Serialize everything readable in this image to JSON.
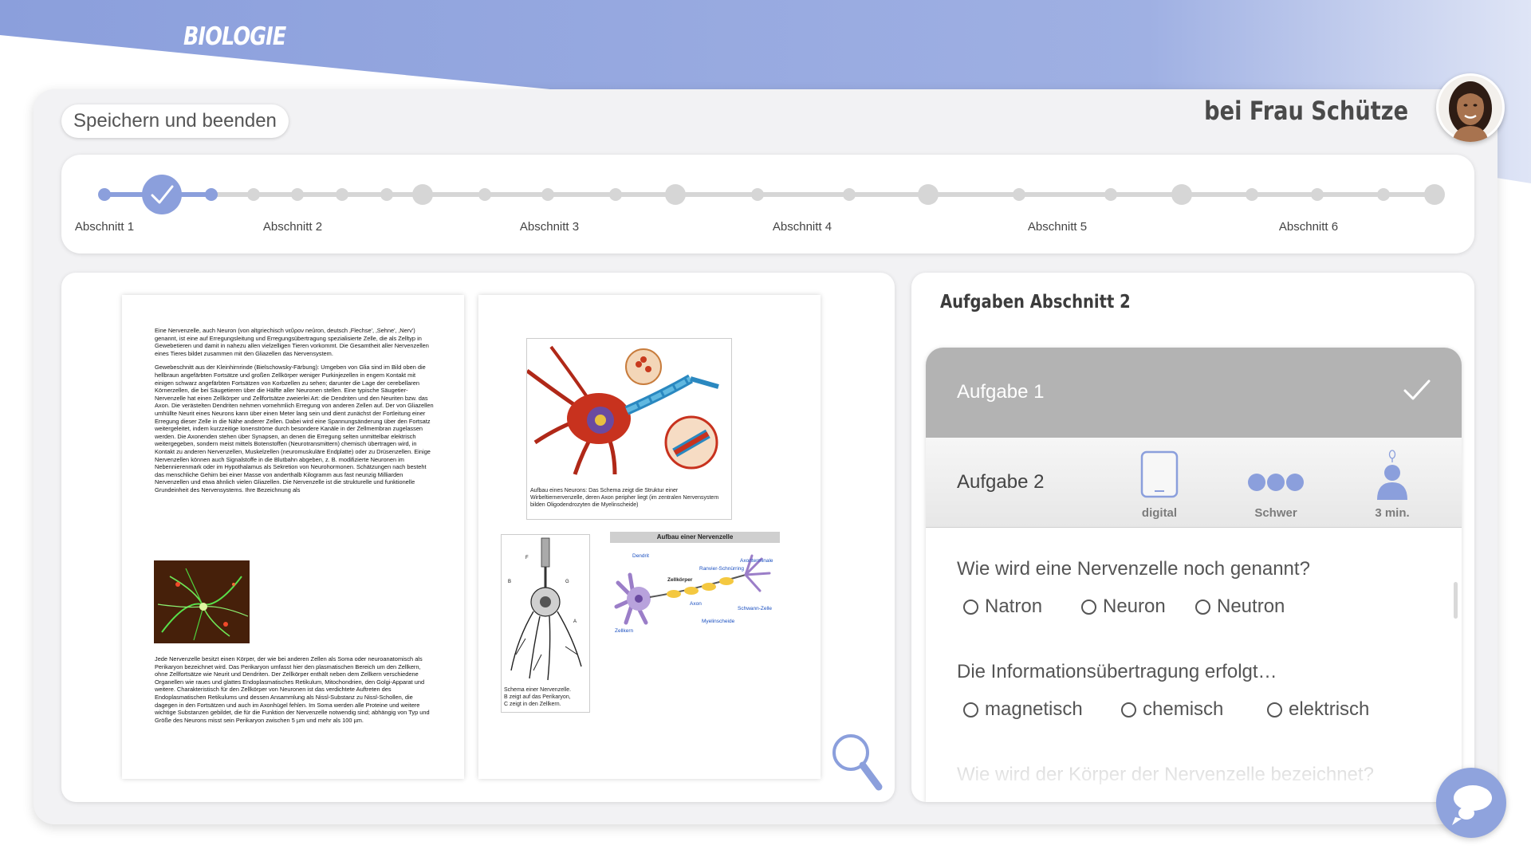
{
  "header": {
    "subject": "BIOLOGIE",
    "teacher": "bei Frau Schütze"
  },
  "toolbar": {
    "save_label": "Speichern und beenden"
  },
  "progress": {
    "steps": [
      "Abschnitt 1",
      "Abschnitt 2",
      "Abschnitt 3",
      "Abschnitt 4",
      "Abschnitt 5",
      "Abschnitt 6"
    ],
    "completed_steps": 1
  },
  "document": {
    "page1_paragraphs": [
      "Eine Nervenzelle, auch Neuron (von altgriechisch νεῦρον neûron, deutsch ‚Flechse', ‚Sehne', ‚Nerv') genannt, ist eine auf Erregungsleitung und Erregungsübertragung spezialisierte Zelle, die als Zelltyp in Gewebetieren und damit in nahezu allen vielzelligen Tieren vorkommt. Die Gesamtheit aller Nervenzellen eines Tieres bildet zusammen mit den Gliazellen das Nervensystem.",
      "Gewebeschnitt aus der Kleinhirnrinde (Bielschowsky-Färbung): Umgeben von Glia sind im Bild oben die hellbraun angefärbten Fortsätze und großen Zellkörper weniger Purkinjezellen in engem Kontakt mit einigen schwarz angefärbten Fortsätzen von Korbzellen zu sehen; darunter die Lage der cerebellaren Körnerzellen, die bei Säugetieren über die Hälfte aller Neuronen stellen. Eine typische Säugetier-Nervenzelle hat einen Zellkörper und Zellfortsätze zweierlei Art: die Dendriten und den Neuriten bzw. das Axon. Die verästelten Dendriten nehmen vornehmlich Erregung von anderen Zellen auf. Der von Gliazellen umhüllte Neurit eines Neurons kann über einen Meter lang sein und dient zunächst der Fortleitung einer Erregung dieser Zelle in die Nähe anderer Zellen. Dabei wird eine Spannungsänderung über den Fortsatz weitergeleitet, indem kurzzeitige Ionenströme durch besondere Kanäle in der Zellmembran zugelassen werden. Die Axonenden stehen über Synapsen, an denen die Erregung selten unmittelbar elektrisch weitergegeben, sondern meist mittels Botenstoffen (Neurotransmittern) chemisch übertragen wird, in Kontakt zu anderen Nervenzellen, Muskelzellen (neuromuskuläre Endplatte) oder zu Drüsenzellen. Einige Nervenzellen können auch Signalstoffe in die Blutbahn abgeben, z. B. modifizierte Neuronen im Nebennierenmark oder im Hypothalamus als Sekretion von Neurohormonen. Schätzungen nach besteht das menschliche Gehirn bei einer Masse von anderthalb Kilogramm aus fast neunzig Milliarden Nervenzellen und etwa ähnlich vielen Gliazellen. Die Nervenzelle ist die strukturelle und funktionelle Grundeinheit des Nervensystems. Ihre Bezeichnung als",
      "Jede Nervenzelle besitzt einen Körper, der wie bei anderen Zellen als Soma oder neuroanatomisch als Perikaryon bezeichnet wird. Das Perikaryon umfasst hier den plasmatischen Bereich um den Zellkern, ohne Zellfortsätze wie Neurit und Dendriten. Der Zellkörper enthält neben dem Zellkern verschiedene Organellen wie raues und glattes Endoplasmatisches Retikulum, Mitochondrien, den Golgi-Apparat und weitere. Charakteristisch für den Zellkörper von Neuronen ist das verdichtete Auftreten des Endoplasmatischen Retikulums und dessen Ansammlung als Nissl-Substanz zu Nissl-Schollen, die dagegen in den Fortsätzen und auch im Axonhügel fehlen. Im Soma werden alle Proteine und weitere wichtige Substanzen gebildet, die für die Funktion der Nervenzelle notwendig sind; abhängig von Typ und Größe des Neurons misst sein Perikaryon zwischen 5 µm und mehr als 100 µm."
    ],
    "fig1_caption": "Aufbau eines Neurons: Das Schema zeigt die Struktur einer Wirbeltiernervenzelle, deren Axon peripher liegt (im zentralen Nervensystem bilden Oligodendrozyten die Myelinscheide)",
    "fig2_caption_lines": [
      "Schema einer Nervenzelle.",
      "B zeigt auf das Perikaryon,",
      "C zeigt in den Zellkern."
    ],
    "fig3_title": "Aufbau einer Nervenzelle",
    "fig3_labels": [
      "Dendrit",
      "Zellkörper",
      "Ranvier-Schnürring",
      "Axonterminale",
      "Axon",
      "Schwann-Zelle",
      "Myelinscheide",
      "Zellkern"
    ]
  },
  "tasks": {
    "heading": "Aufgaben Abschnitt 2",
    "task1": {
      "label": "Aufgabe 1",
      "done": true
    },
    "task2": {
      "label": "Aufgabe 2",
      "mode": "digital",
      "difficulty": "Schwer",
      "duration": "3 min."
    },
    "questions": [
      {
        "text": "Wie wird eine Nervenzelle noch genannt?",
        "options": [
          "Natron",
          "Neuron",
          "Neutron"
        ]
      },
      {
        "text": "Die Informationsübertragung erfolgt…",
        "options": [
          "magnetisch",
          "chemisch",
          "elektrisch"
        ]
      },
      {
        "text": "Wie wird der Körper der Nervenzelle bezeichnet?"
      }
    ]
  },
  "icons": {
    "check": "check-icon",
    "tablet": "tablet-icon",
    "difficulty": "difficulty-dots-icon",
    "person": "person-icon",
    "zoom": "magnifier-icon",
    "chat": "chat-bubble-icon"
  },
  "colors": {
    "accent": "#8fa3dd",
    "accent_dark": "#7e93d6",
    "done_row": "#b3b3b3"
  }
}
